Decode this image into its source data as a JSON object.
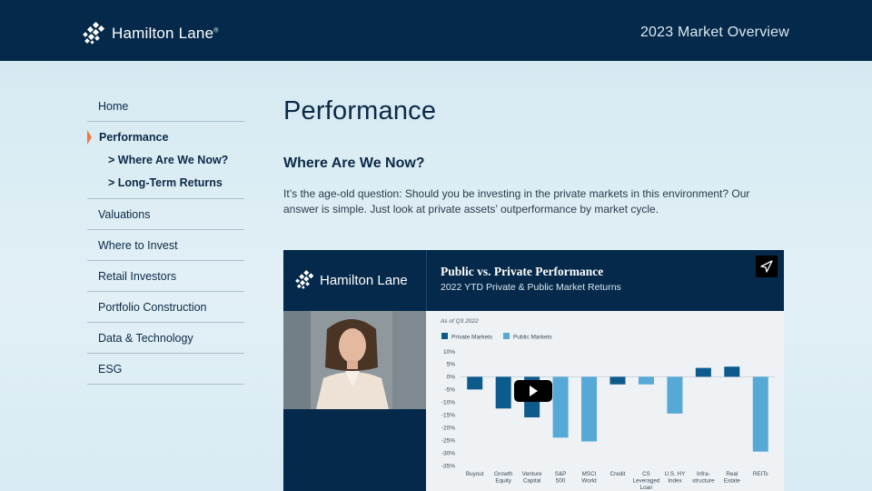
{
  "header": {
    "brand_name": "Hamilton Lane",
    "brand_tm": "®",
    "title": "2023 Market Overview"
  },
  "sidebar": {
    "items_before": [
      {
        "label": "Home"
      }
    ],
    "active": {
      "label": "Performance"
    },
    "sub_items": [
      {
        "label": "> Where Are We Now?"
      },
      {
        "label": "> Long-Term Returns"
      }
    ],
    "items_after": [
      {
        "label": "Valuations"
      },
      {
        "label": "Where to Invest"
      },
      {
        "label": "Retail Investors"
      },
      {
        "label": "Portfolio Construction"
      },
      {
        "label": "Data & Technology"
      },
      {
        "label": "ESG"
      }
    ]
  },
  "main": {
    "title": "Performance",
    "section_heading": "Where Are We Now?",
    "body": "It’s the age-old question: Should you be investing in the private markets in this environment? Our answer is simple. Just look at private assets’ outperformance by market cycle."
  },
  "video": {
    "logo_name": "Hamilton Lane",
    "title": "Public vs. Private Performance",
    "subtitle": "2022 YTD Private & Public Market Returns",
    "icons": {
      "share": "share-arrow-icon",
      "play": "play-icon"
    }
  },
  "colors": {
    "navy": "#05294a",
    "accent_orange": "#f07a3b",
    "private_bar": "#0d5a8c",
    "public_bar": "#56a9d6"
  },
  "chart_data": {
    "type": "bar",
    "note": "As of Q3 2022",
    "categories": [
      [
        "Buyout"
      ],
      [
        "Growth",
        "Equity"
      ],
      [
        "Venture",
        "Capital"
      ],
      [
        "S&P",
        "500"
      ],
      [
        "MSCI",
        "World"
      ],
      [
        "Credit"
      ],
      [
        "CS",
        "Leveraged",
        "Loan"
      ],
      [
        "U.S. HY",
        "Index"
      ],
      [
        "Infra-",
        "structure"
      ],
      [
        "Real",
        "Estate"
      ],
      [
        "REITs"
      ]
    ],
    "series": [
      {
        "name": "Private Markets",
        "color": "#0d5a8c",
        "values": [
          -5,
          -12.5,
          -16,
          null,
          null,
          -3,
          null,
          null,
          3.5,
          4,
          null
        ]
      },
      {
        "name": "Public Markets",
        "color": "#56a9d6",
        "values": [
          null,
          null,
          null,
          -24,
          -25.5,
          null,
          -3,
          -14.5,
          null,
          null,
          -29.5
        ]
      }
    ],
    "ylim": [
      -35,
      10
    ],
    "yticks": [
      10,
      5,
      0,
      -5,
      -10,
      -15,
      -20,
      -25,
      -30,
      -35
    ],
    "ytick_labels": [
      "10%",
      "5%",
      "0%",
      "-5%",
      "-10%",
      "-15%",
      "-20%",
      "-25%",
      "-30%",
      "-35%"
    ],
    "legend_position": "top-left"
  }
}
